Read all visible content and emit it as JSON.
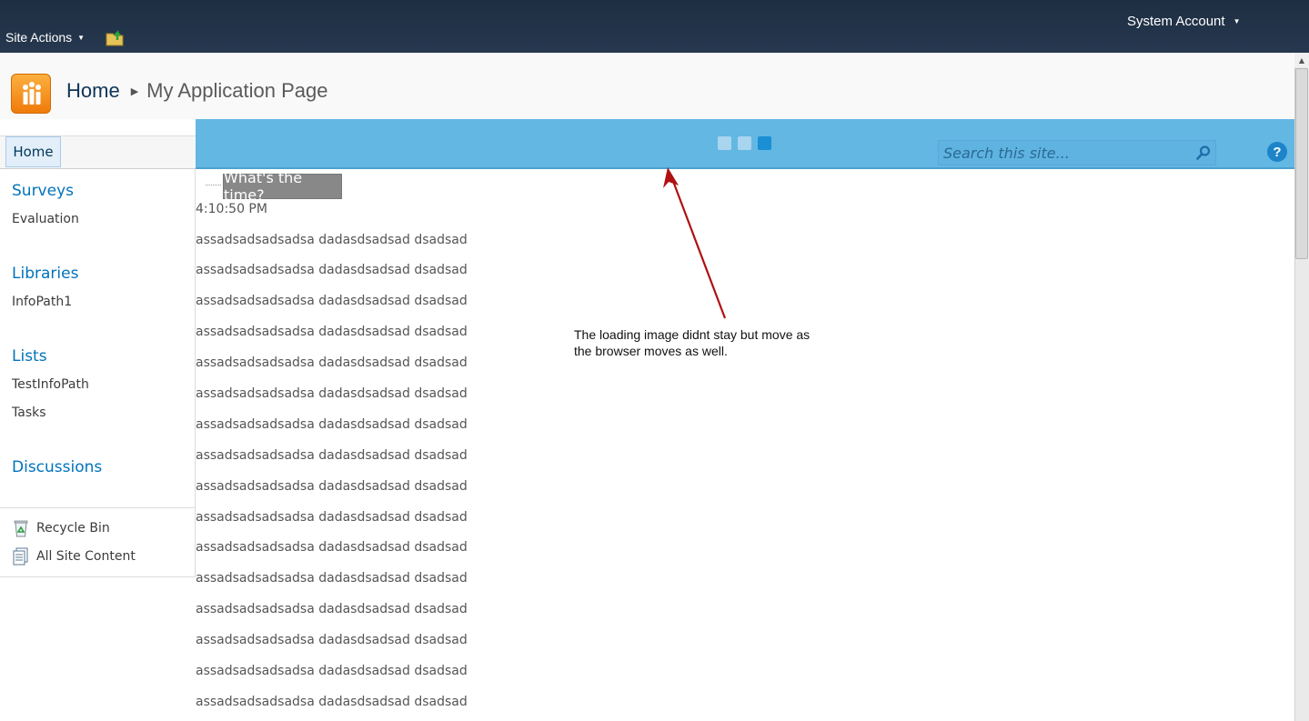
{
  "ribbon": {
    "site_actions": "Site Actions",
    "account": "System Account"
  },
  "title": {
    "breadcrumb_home": "Home",
    "breadcrumb_page": "My Application Page"
  },
  "topnav": {
    "home_tab": "Home",
    "search_placeholder": "Search this site...",
    "help": "?"
  },
  "leftnav": {
    "surveys": {
      "heading": "Surveys",
      "items": [
        "Evaluation"
      ]
    },
    "libraries": {
      "heading": "Libraries",
      "items": [
        "InfoPath1"
      ]
    },
    "lists": {
      "heading": "Lists",
      "items": [
        "TestInfoPath",
        "Tasks"
      ]
    },
    "discussions": {
      "heading": "Discussions"
    },
    "recycle_bin": "Recycle Bin",
    "all_site_content": "All Site Content"
  },
  "content": {
    "time_button": "What's the time?",
    "time_value": "4:10:50 PM",
    "lines": [
      "assadsadsadsadsa dadasdsadsad dsadsad",
      "assadsadsadsadsa dadasdsadsad dsadsad",
      "assadsadsadsadsa dadasdsadsad dsadsad",
      "assadsadsadsadsa dadasdsadsad dsadsad",
      "assadsadsadsadsa dadasdsadsad dsadsad",
      "assadsadsadsadsa dadasdsadsad dsadsad",
      "assadsadsadsadsa dadasdsadsad dsadsad",
      "assadsadsadsadsa dadasdsadsad dsadsad",
      "assadsadsadsadsa dadasdsadsad dsadsad",
      "assadsadsadsadsa dadasdsadsad dsadsad",
      "assadsadsadsadsa dadasdsadsad dsadsad",
      "assadsadsadsadsa dadasdsadsad dsadsad",
      "assadsadsadsadsa dadasdsadsad dsadsad",
      "assadsadsadsadsa dadasdsadsad dsadsad",
      "assadsadsadsadsa dadasdsadsad dsadsad",
      "assadsadsadsadsa dadasdsadsad dsadsad"
    ]
  },
  "annotation": {
    "line1": "The loading image didnt stay but move as",
    "line2": "the browser moves as well."
  },
  "colors": {
    "ribbon_bg": "#1e2e42",
    "topnav_blue": "#63b7e3",
    "nav_heading": "#0072bc",
    "arrow": "#b01010"
  }
}
